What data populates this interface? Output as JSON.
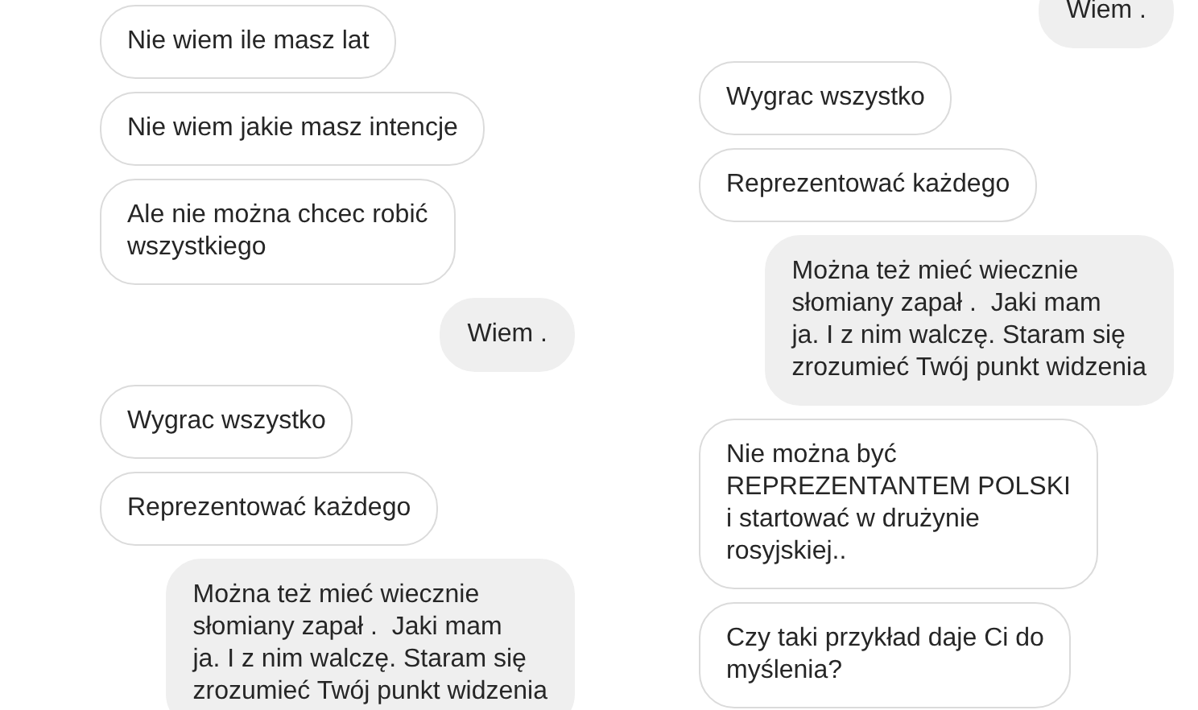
{
  "panels": [
    {
      "messages": [
        {
          "kind": "received",
          "text": "Nie wiem ile masz lat"
        },
        {
          "kind": "received",
          "text": "Nie wiem jakie masz intencje"
        },
        {
          "kind": "received",
          "text": "Ale nie można chcec robić\nwszystkiego"
        },
        {
          "kind": "sent",
          "text": "Wiem ."
        },
        {
          "kind": "received",
          "text": "Wygrac wszystko"
        },
        {
          "kind": "received",
          "text": "Reprezentować każdego"
        },
        {
          "kind": "sent",
          "text": "Można też mieć wiecznie\nsłomiany zapał .  Jaki mam\nja. I z nim walczę. Staram się\nzrozumieć Twój punkt widzenia"
        }
      ]
    },
    {
      "messages": [
        {
          "kind": "sent",
          "text": "Wiem ."
        },
        {
          "kind": "received",
          "text": "Wygrac wszystko"
        },
        {
          "kind": "received",
          "text": "Reprezentować każdego"
        },
        {
          "kind": "sent",
          "text": "Można też mieć wiecznie\nsłomiany zapał .  Jaki mam\nja. I z nim walczę. Staram się\nzrozumieć Twój punkt widzenia"
        },
        {
          "kind": "received",
          "text": "Nie można być\nREPREZENTANTEM POLSKI\ni startować w drużynie\nrosyjskiej.."
        },
        {
          "kind": "received",
          "text": "Czy taki przykład daje Ci do\nmyślenia?"
        }
      ]
    }
  ]
}
